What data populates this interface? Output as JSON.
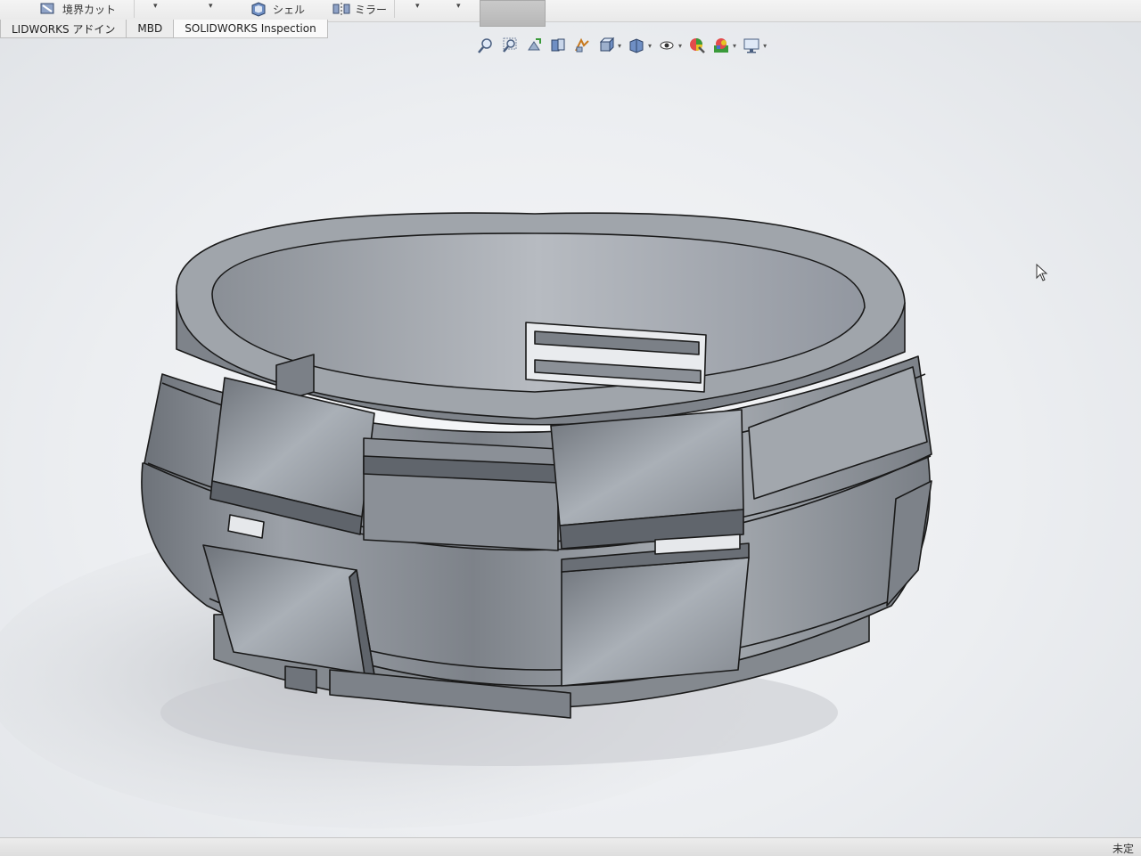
{
  "ribbon": {
    "boundary_cut_label": "境界カット",
    "shell_label": "シェル",
    "mirror_label": "ミラー"
  },
  "tabs": [
    {
      "label": "LIDWORKS アドイン"
    },
    {
      "label": "MBD"
    },
    {
      "label": "SOLIDWORKS Inspection"
    }
  ],
  "heads_up_toolbar": [
    "zoom-to-fit-icon",
    "zoom-to-area-icon",
    "previous-view-icon",
    "section-view-icon",
    "dynamic-annotation-view-icon",
    "view-orientation-icon",
    "display-style-icon",
    "hide-show-items-icon",
    "edit-appearance-icon",
    "apply-scene-icon",
    "view-settings-icon"
  ],
  "model": {
    "name": "slotted ring part",
    "color": "#8e939a"
  },
  "status": {
    "text": "未定"
  },
  "colors": {
    "viewport_bg": "#eceef1",
    "model_face": "#8e939a",
    "model_edge": "#1a1a1a"
  }
}
